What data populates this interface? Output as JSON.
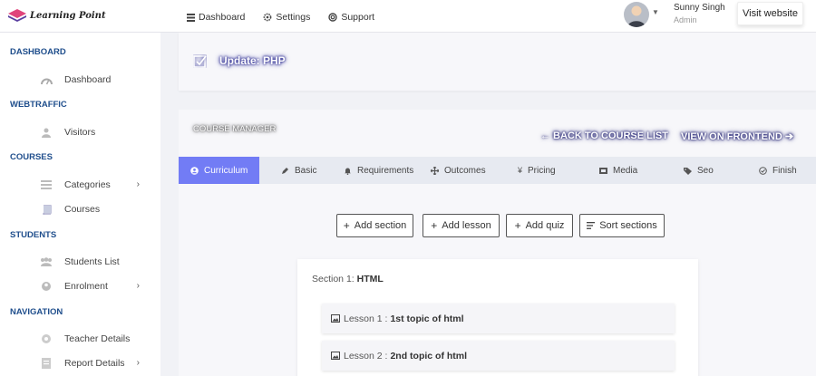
{
  "app": {
    "logo_text": "Learning Point"
  },
  "topnav": [
    {
      "label": "Dashboard",
      "icon": "list-icon"
    },
    {
      "label": "Settings",
      "icon": "gear-icon"
    },
    {
      "label": "Support",
      "icon": "lifebuoy-icon"
    }
  ],
  "user": {
    "name": "Sunny Singh",
    "role": "Admin",
    "visit_label": "Visit website"
  },
  "sidebar": {
    "sections": [
      {
        "title": "DASHBOARD",
        "items": [
          {
            "label": "Dashboard",
            "icon": "dashboard-icon",
            "chevron": false
          }
        ]
      },
      {
        "title": "WEBTRAFFIC",
        "items": [
          {
            "label": "Visitors",
            "icon": "users-icon",
            "chevron": false
          }
        ]
      },
      {
        "title": "COURSES",
        "items": [
          {
            "label": "Categories",
            "icon": "layers-icon",
            "chevron": true
          },
          {
            "label": "Courses",
            "icon": "book-icon",
            "chevron": false
          }
        ]
      },
      {
        "title": "STUDENTS",
        "items": [
          {
            "label": "Students List",
            "icon": "group-icon",
            "chevron": false
          },
          {
            "label": "Enrolment",
            "icon": "user-plus-icon",
            "chevron": true
          }
        ]
      },
      {
        "title": "NAVIGATION",
        "items": [
          {
            "label": "Teacher Details",
            "icon": "globe-icon",
            "chevron": false
          },
          {
            "label": "Report Details",
            "icon": "report-icon",
            "chevron": true
          }
        ]
      }
    ]
  },
  "update": {
    "title": "Update: PHP"
  },
  "course_manager": {
    "title": "COURSE MANAGER",
    "back_link": "← BACK TO COURSE LIST",
    "frontend_link": "VIEW ON FRONTEND ➔",
    "tabs": [
      {
        "label": "Curriculum",
        "icon": "circle-user-icon",
        "active": true
      },
      {
        "label": "Basic",
        "icon": "pencil-icon",
        "active": false
      },
      {
        "label": "Requirements",
        "icon": "bell-icon",
        "active": false
      },
      {
        "label": "Outcomes",
        "icon": "move-icon",
        "active": false
      },
      {
        "label": "Pricing",
        "icon": "yen-icon",
        "active": false
      },
      {
        "label": "Media",
        "icon": "media-icon",
        "active": false
      },
      {
        "label": "Seo",
        "icon": "tag-icon",
        "active": false
      },
      {
        "label": "Finish",
        "icon": "check-circle-icon",
        "active": false
      }
    ],
    "actions": {
      "add_section": "Add section",
      "add_lesson": "Add lesson",
      "add_quiz": "Add quiz",
      "sort_sections": "Sort sections"
    },
    "section": {
      "prefix": "Section 1:",
      "name": "HTML",
      "lessons": [
        {
          "prefix": "Lesson 1 :",
          "title": "1st topic of html"
        },
        {
          "prefix": "Lesson 2 :",
          "title": "2nd topic of html"
        }
      ]
    }
  },
  "colors": {
    "accent": "#727cf5",
    "sidebar_heading": "#1f4e8c",
    "tab_bar": "#e7eaf1"
  }
}
